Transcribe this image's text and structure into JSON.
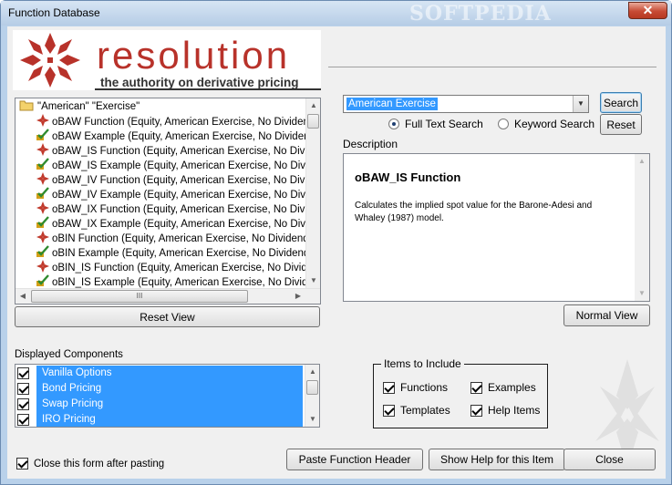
{
  "window": {
    "title": "Function Database",
    "watermark": "SOFTPEDIA",
    "close_symbol": "✕"
  },
  "logo": {
    "word": "resolution",
    "tagline": "the authority on derivative pricing",
    "icon": "star-logo-icon",
    "color": "#b8322a"
  },
  "tree": {
    "root_label": "\"American\" \"Exercise\"",
    "items": [
      {
        "label": "oBAW Function (Equity, American Exercise, No Dividend)",
        "icon": "function-icon"
      },
      {
        "label": "oBAW Example (Equity, American Exercise, No Dividend)",
        "icon": "example-icon"
      },
      {
        "label": "oBAW_IS Function (Equity, American Exercise, No Dividen",
        "icon": "function-icon"
      },
      {
        "label": "oBAW_IS Example (Equity, American Exercise, No Dividen",
        "icon": "example-icon"
      },
      {
        "label": "oBAW_IV Function (Equity, American Exercise, No Divider",
        "icon": "function-icon"
      },
      {
        "label": "oBAW_IV Example (Equity, American Exercise, No Divider",
        "icon": "example-icon"
      },
      {
        "label": "oBAW_IX Function (Equity, American Exercise, No Divide",
        "icon": "function-icon"
      },
      {
        "label": "oBAW_IX Example (Equity, American Exercise, No Divide",
        "icon": "example-icon"
      },
      {
        "label": "oBIN Function (Equity, American Exercise, No Dividend)",
        "icon": "function-icon"
      },
      {
        "label": "oBIN Example (Equity, American Exercise, No Dividend)",
        "icon": "example-icon"
      },
      {
        "label": "oBIN_IS Function (Equity, American Exercise, No Dividend",
        "icon": "function-icon"
      },
      {
        "label": "oBIN_IS Example (Equity, American Exercise, No Dividenc",
        "icon": "example-icon"
      }
    ],
    "hscroll_grip": "III"
  },
  "buttons": {
    "reset_view": "Reset View",
    "search": "Search",
    "reset": "Reset",
    "normal_view": "Normal View",
    "paste_header": "Paste Function Header",
    "show_help": "Show Help for this Item",
    "close": "Close"
  },
  "search": {
    "value": "American Exercise",
    "full_text_label": "Full Text Search",
    "keyword_label": "Keyword Search",
    "mode": "full_text"
  },
  "description": {
    "label": "Description",
    "title": "oBAW_IS Function",
    "body": "Calculates the implied spot value for the Barone-Adesi and Whaley (1987) model."
  },
  "components": {
    "label": "Displayed Components",
    "items": [
      {
        "label": "Vanilla Options",
        "checked": true
      },
      {
        "label": "Bond Pricing",
        "checked": true
      },
      {
        "label": "Swap Pricing",
        "checked": true
      },
      {
        "label": "IRO Pricing",
        "checked": true
      }
    ]
  },
  "include": {
    "legend": "Items to Include",
    "functions": "Functions",
    "examples": "Examples",
    "templates": "Templates",
    "help_items": "Help Items"
  },
  "close_after_paste": {
    "label": "Close this form after pasting",
    "checked": true
  },
  "colors": {
    "selection": "#3399ff",
    "window_frame": "#b9d1ea"
  }
}
